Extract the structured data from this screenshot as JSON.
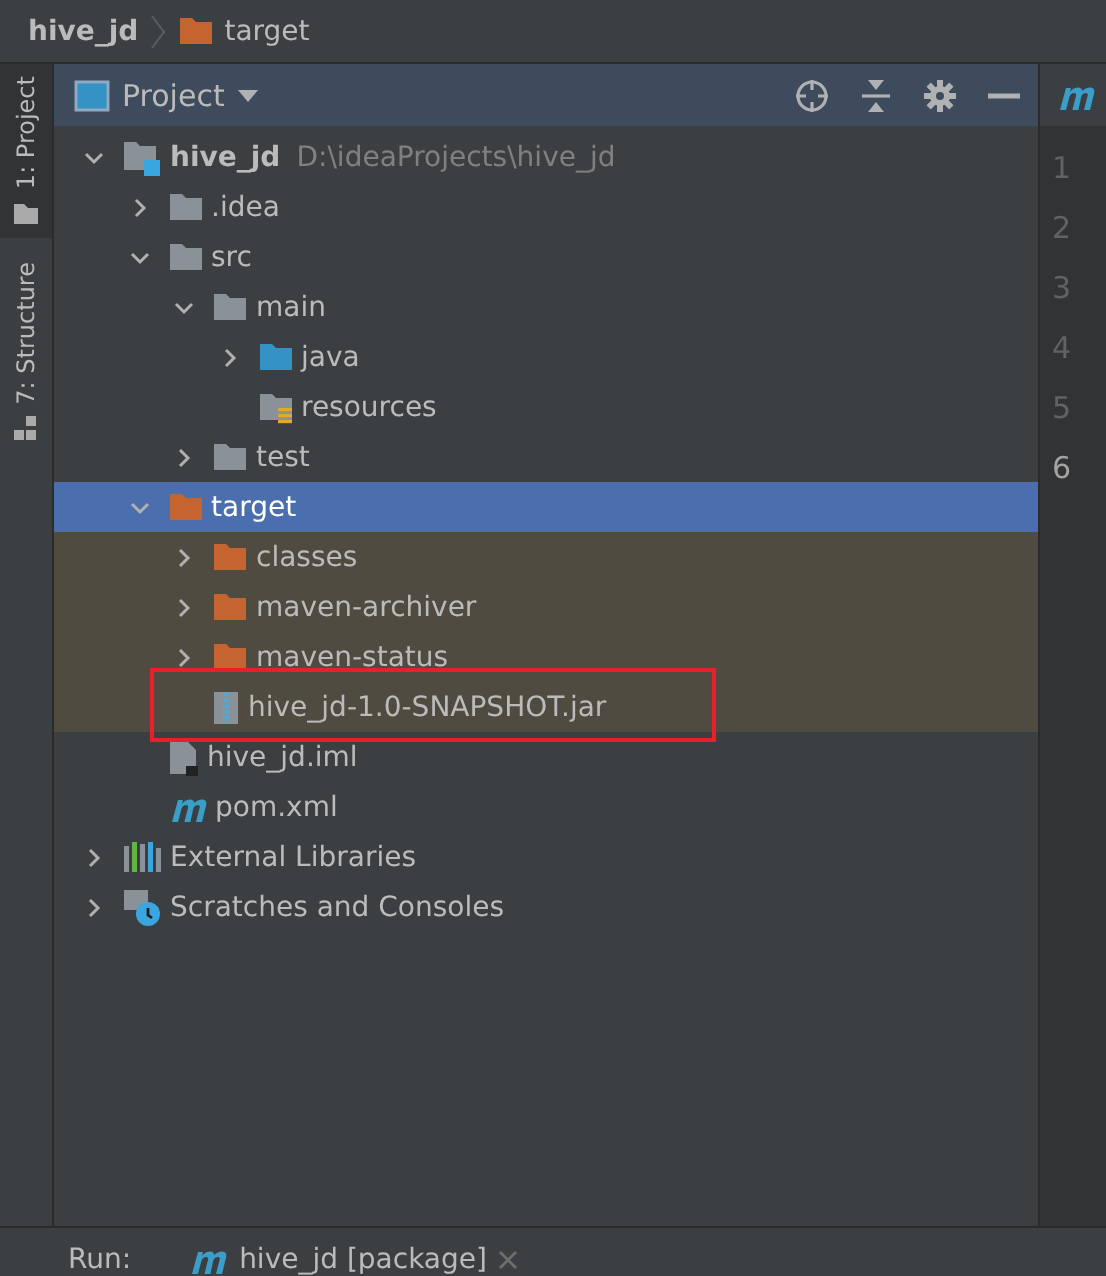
{
  "breadcrumbs": [
    {
      "label": "hive_jd"
    },
    {
      "label": "target",
      "kind": "excluded-folder"
    }
  ],
  "side_tabs": [
    {
      "label": "1: Project",
      "kind": "project",
      "selected": true
    },
    {
      "label": "7: Structure",
      "kind": "structure",
      "selected": false
    }
  ],
  "panel": {
    "title": "Project"
  },
  "tree": [
    {
      "label": "hive_jd",
      "hint": "D:\\ideaProjects\\hive_jd",
      "kind": "module",
      "expanded": true,
      "selected": false,
      "excluded": false,
      "annotated": false,
      "children": [
        {
          "label": ".idea",
          "kind": "folder",
          "expanded": false,
          "selected": false,
          "excluded": false,
          "annotated": false
        },
        {
          "label": "src",
          "kind": "folder",
          "expanded": true,
          "selected": false,
          "excluded": false,
          "annotated": false,
          "children": [
            {
              "label": "main",
              "kind": "folder",
              "expanded": true,
              "selected": false,
              "excluded": false,
              "annotated": false,
              "children": [
                {
                  "label": "java",
                  "kind": "source-folder",
                  "expanded": false,
                  "selected": false,
                  "excluded": false,
                  "annotated": false
                },
                {
                  "label": "resources",
                  "kind": "resource-folder",
                  "selected": false,
                  "excluded": false,
                  "annotated": false
                }
              ]
            },
            {
              "label": "test",
              "kind": "folder",
              "expanded": false,
              "selected": false,
              "excluded": false,
              "annotated": false
            }
          ]
        },
        {
          "label": "target",
          "kind": "excluded-folder",
          "expanded": true,
          "selected": true,
          "excluded": true,
          "annotated": false,
          "children": [
            {
              "label": "classes",
              "kind": "excluded-folder",
              "expanded": false,
              "selected": false,
              "excluded": true,
              "annotated": false
            },
            {
              "label": "maven-archiver",
              "kind": "excluded-folder",
              "expanded": false,
              "selected": false,
              "excluded": true,
              "annotated": false
            },
            {
              "label": "maven-status",
              "kind": "excluded-folder",
              "expanded": false,
              "selected": false,
              "excluded": true,
              "annotated": false
            },
            {
              "label": "hive_jd-1.0-SNAPSHOT.jar",
              "kind": "jar",
              "selected": false,
              "excluded": true,
              "annotated": true
            }
          ]
        },
        {
          "label": "hive_jd.iml",
          "kind": "iml",
          "selected": false,
          "excluded": false,
          "annotated": false
        },
        {
          "label": "pom.xml",
          "kind": "maven",
          "selected": false,
          "excluded": false,
          "annotated": false
        }
      ]
    },
    {
      "label": "External Libraries",
      "kind": "libraries",
      "expanded": false,
      "selected": false,
      "excluded": false,
      "annotated": false
    },
    {
      "label": "Scratches and Consoles",
      "kind": "scratches",
      "expanded": false,
      "selected": false,
      "excluded": false,
      "annotated": false
    }
  ],
  "editor": {
    "tab": {
      "kind": "maven"
    },
    "line_numbers": [
      {
        "label": "1",
        "current": false
      },
      {
        "label": "2",
        "current": false
      },
      {
        "label": "3",
        "current": false
      },
      {
        "label": "4",
        "current": false
      },
      {
        "label": "5",
        "current": false
      },
      {
        "label": "6",
        "current": true
      }
    ]
  },
  "run_bar": {
    "label": "Run:",
    "tab": {
      "label": "hive_jd [package]",
      "kind": "maven"
    }
  }
}
